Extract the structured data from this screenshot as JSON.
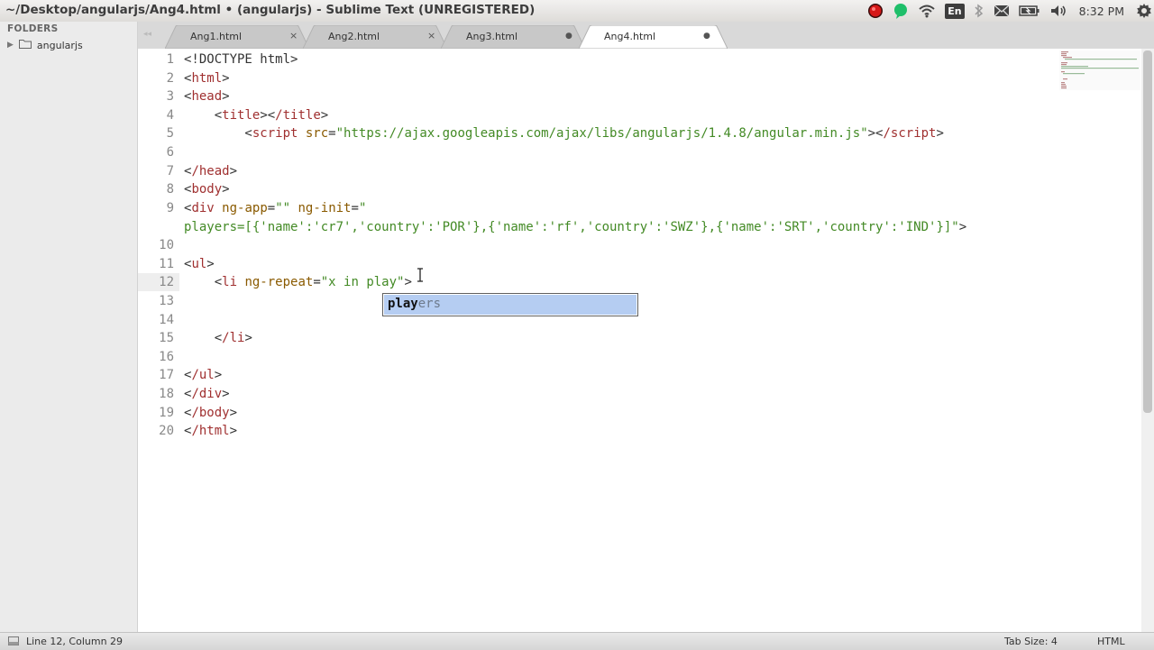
{
  "window": {
    "title": "~/Desktop/angularjs/Ang4.html • (angularjs) - Sublime Text (UNREGISTERED)"
  },
  "tray": {
    "keyboard_layout": "En",
    "clock": "8:32 PM",
    "icons": [
      "record-indicator-icon",
      "chat-icon",
      "wifi-icon",
      "keyboard-icon",
      "mail-icon",
      "bluetooth-icon",
      "battery-icon",
      "volume-icon",
      "settings-gear-icon"
    ]
  },
  "sidebar": {
    "header": "FOLDERS",
    "folders": [
      {
        "name": "angularjs",
        "expanded": false
      }
    ]
  },
  "tabs": [
    {
      "label": "Ang1.html",
      "control": "×",
      "active": false
    },
    {
      "label": "Ang2.html",
      "control": "×",
      "active": false
    },
    {
      "label": "Ang3.html",
      "control": "●",
      "active": false
    },
    {
      "label": "Ang4.html",
      "control": "●",
      "active": true
    }
  ],
  "editor": {
    "current_line": 12,
    "line_numbers": [
      "1",
      "2",
      "3",
      "4",
      "5",
      "6",
      "7",
      "8",
      "9",
      "",
      "10",
      "11",
      "12",
      "13",
      "14",
      "15",
      "16",
      "17",
      "18",
      "19",
      "20"
    ],
    "lines": {
      "l1_doctype": "<!DOCTYPE html>",
      "l2_html": "html",
      "l3_head": "head",
      "l4_title": "title",
      "l4_title_close": "/title",
      "l5_script": "script",
      "l5_src_attr": "src",
      "l5_src_value": "\"https://ajax.googleapis.com/ajax/libs/angularjs/1.4.8/angular.min.js\"",
      "l5_script_close": "/script",
      "l7_head_close": "/head",
      "l8_body": "body",
      "l9_div": "div",
      "l9_ngapp_attr": "ng-app",
      "l9_ngapp_value": "\"\"",
      "l9_nginit_attr": "ng-init",
      "l9_nginit_value_start": "\"",
      "l9b_players": "players=[{'name':'cr7','country':'POR'},{'name':'rf','country':'SWZ'},{'name':'SRT','country':'IND'}]\"",
      "l11_ul": "ul",
      "l12_li": "li",
      "l12_ngrepeat_attr": "ng-repeat",
      "l12_ngrepeat_value": "\"x in play\"",
      "l15_li_close": "/li",
      "l17_ul_close": "/ul",
      "l18_div_close": "/div",
      "l19_body_close": "/body",
      "l20_html_close": "/html"
    }
  },
  "autocomplete": {
    "match": "play",
    "rest": "ers"
  },
  "status": {
    "position": "Line 12, Column 29",
    "tab_size": "Tab Size: 4",
    "syntax": "HTML"
  },
  "colors": {
    "tag": "#a03030",
    "attribute": "#8a5a00",
    "string": "#438a25",
    "autocomplete_highlight": "#b5cdf2"
  }
}
